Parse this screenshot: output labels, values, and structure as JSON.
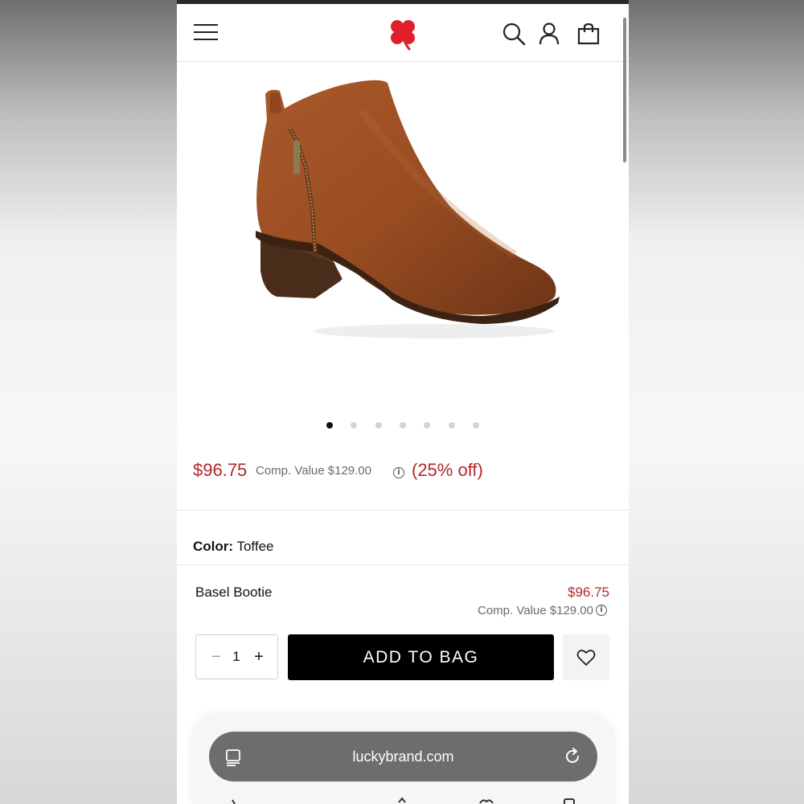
{
  "header": {
    "menu_icon": "hamburger-menu-icon",
    "logo_icon": "clover-logo-icon",
    "search_icon": "search-icon",
    "account_icon": "user-icon",
    "bag_icon": "shopping-bag-icon"
  },
  "gallery": {
    "image_subject": "boot-image",
    "slide_count": 7,
    "active_index": 0
  },
  "pricing": {
    "price": "$96.75",
    "comp_value": "Comp. Value $129.00",
    "discount": "(25% off)",
    "info_icon": "info-icon"
  },
  "color": {
    "label": "Color:",
    "value": "Toffee"
  },
  "line_item": {
    "name": "Basel Bootie",
    "price": "$96.75",
    "comp_value": "Comp. Value $129.00"
  },
  "purchase": {
    "quantity": "1",
    "minus_label": "−",
    "plus_label": "+",
    "add_to_bag_label": "ADD TO BAG",
    "wishlist_icon": "heart-icon"
  },
  "browser": {
    "url": "luckybrand.com",
    "reader_icon": "reader-mode-icon",
    "reload_icon": "reload-icon"
  },
  "colors": {
    "accent_red": "#b1282c",
    "button_black": "#000000",
    "url_pill": "#6d6d6d"
  }
}
